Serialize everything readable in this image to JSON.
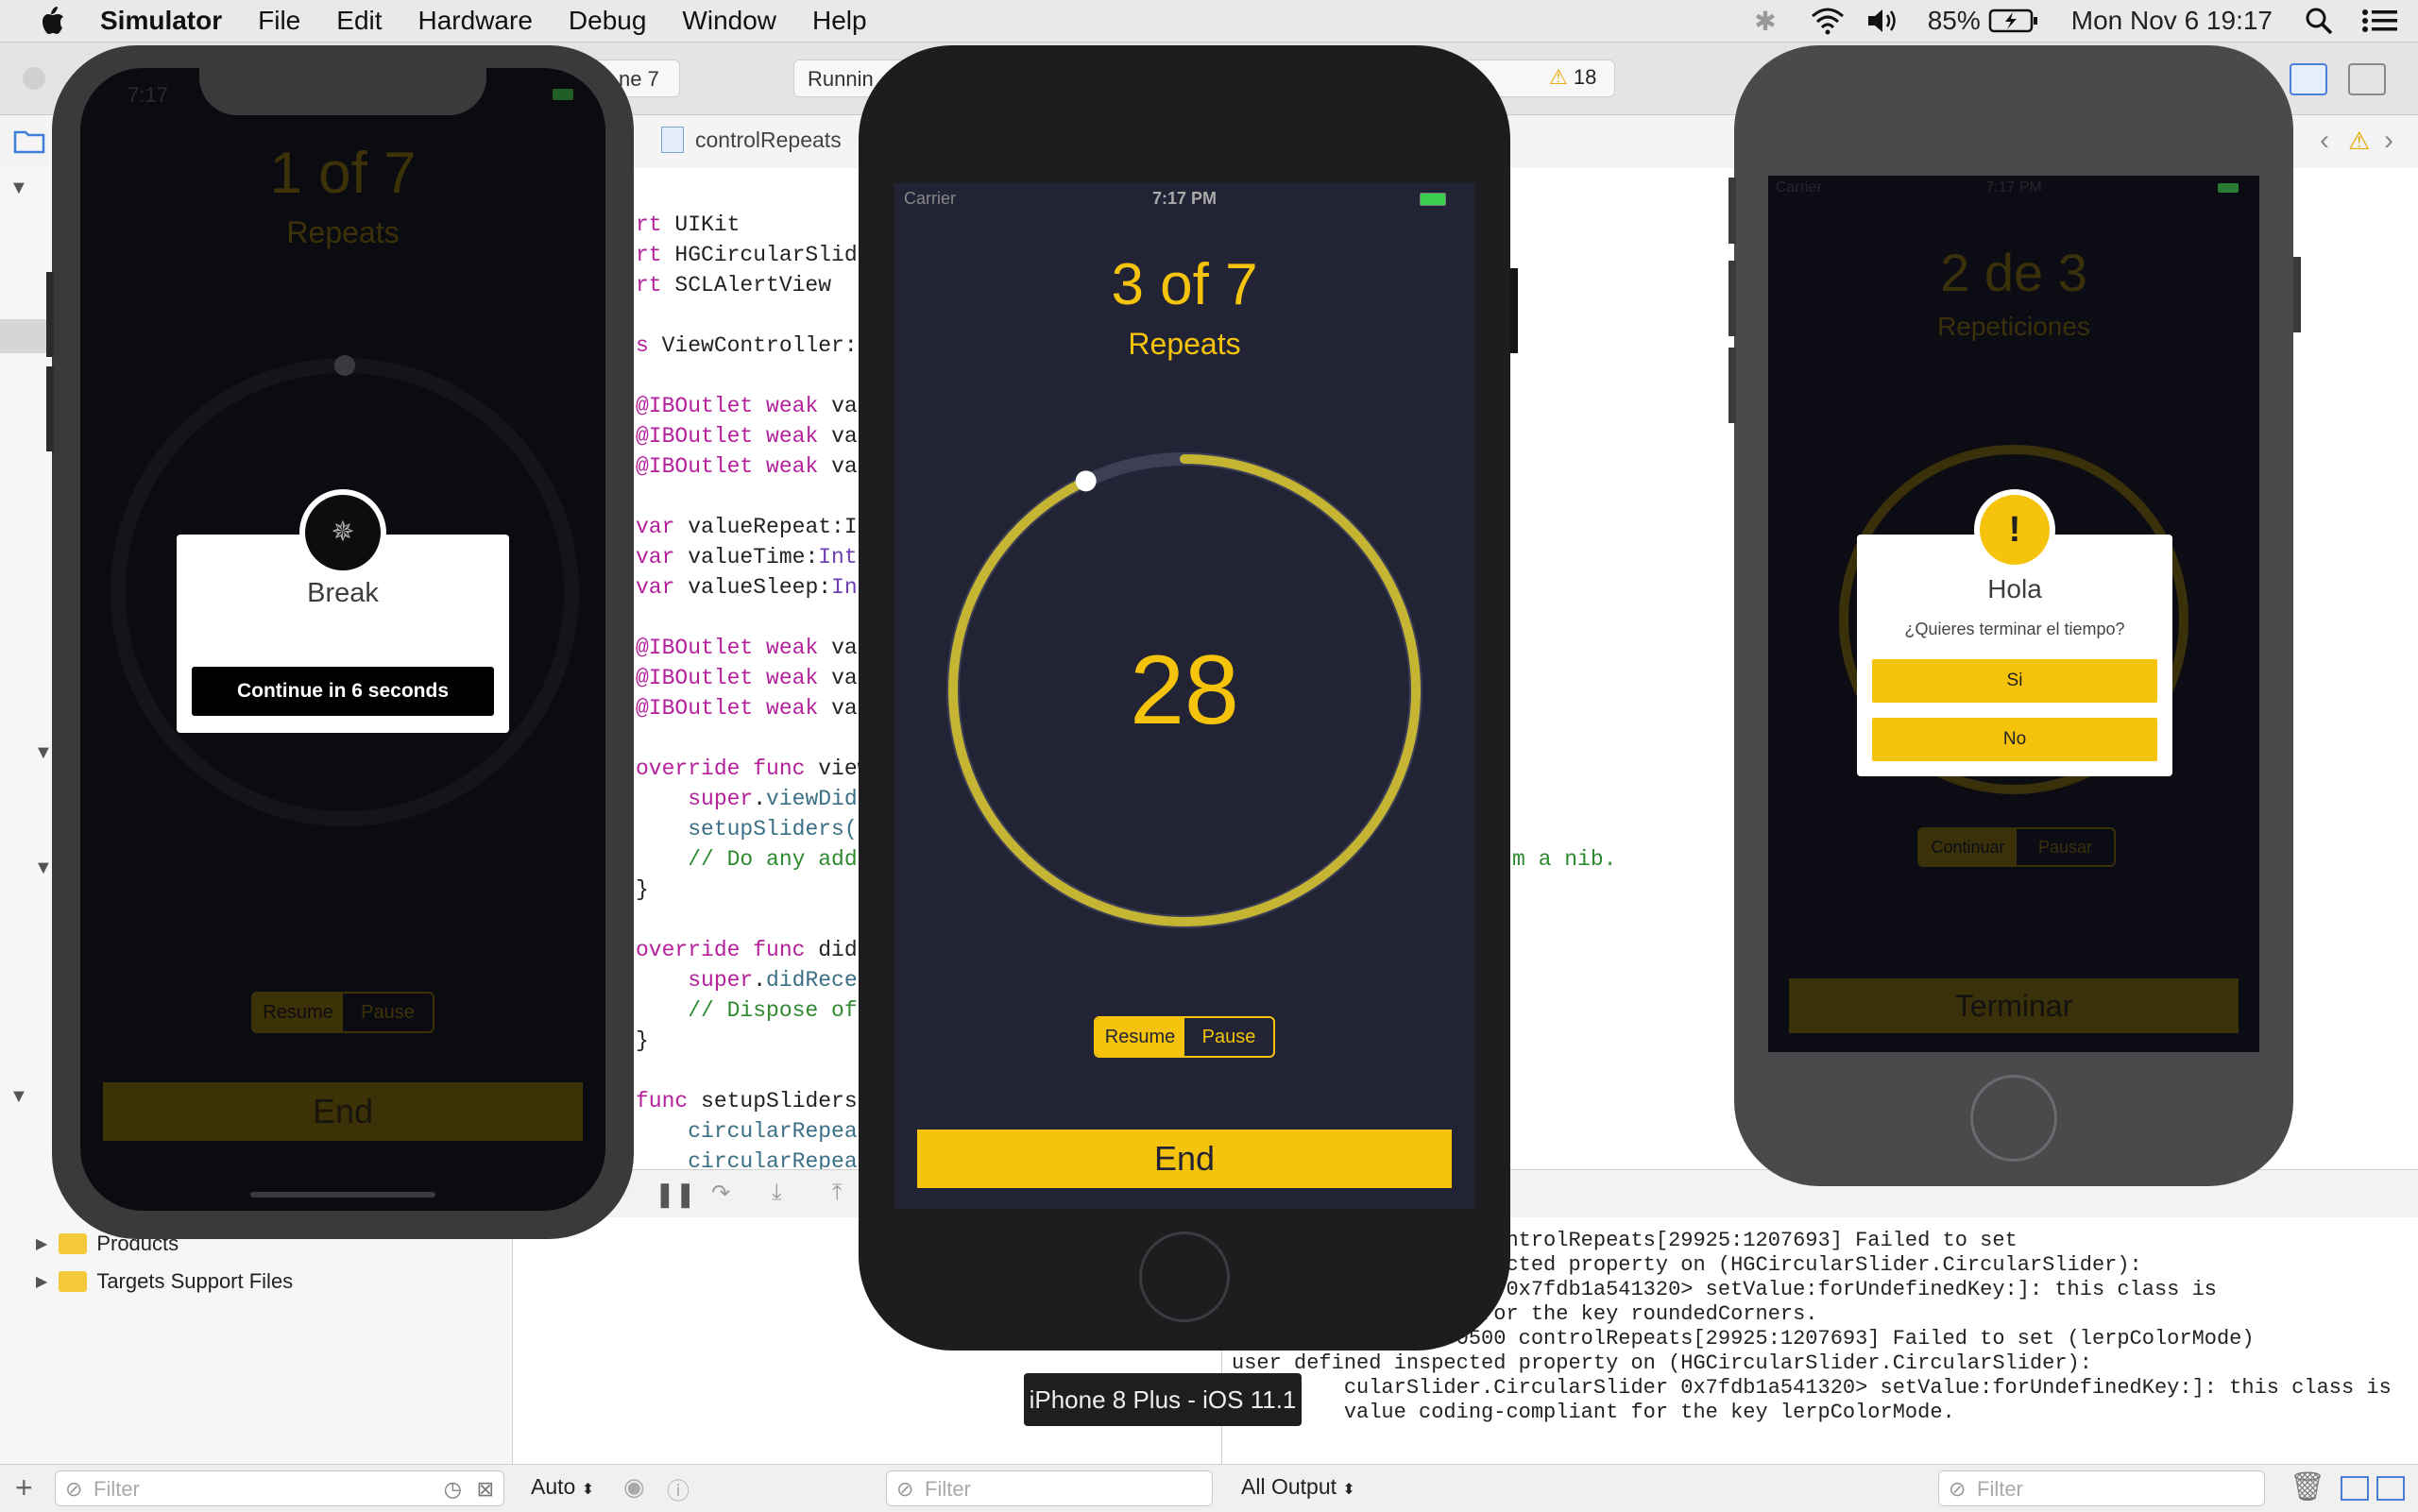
{
  "menubar": {
    "app": "Simulator",
    "items": [
      "File",
      "Edit",
      "Hardware",
      "Debug",
      "Window",
      "Help"
    ],
    "battery": "85%",
    "datetime": "Mon Nov 6  19:17"
  },
  "toolbar": {
    "scheme_fragment": "ne 7",
    "status_fragment": "Runnin",
    "warning_count": "18"
  },
  "navbar": {
    "file_crumb": "controlRepeats"
  },
  "navigator": {
    "items": [
      "Products",
      "Targets Support Files"
    ],
    "filter_placeholder": "Filter"
  },
  "editor": {
    "lines": [
      "rt UIKit",
      "rt HGCircularSlide",
      "rt SCLAlertView",
      "",
      "s ViewController:",
      "",
      "@IBOutlet weak va",
      "@IBOutlet weak va",
      "@IBOutlet weak va",
      "",
      "var valueRepeat:I",
      "var valueTime:Int",
      "var valueSleep:Int",
      "",
      "@IBOutlet weak va",
      "@IBOutlet weak va",
      "@IBOutlet weak va",
      "",
      "override func view",
      "    super.viewDid",
      "    setupSliders(",
      "    // Do any addi",
      "}",
      "",
      "override func didR",
      "    super.didRece",
      "    // Dispose of",
      "}",
      "",
      "func setupSliders",
      "    circularRepea",
      "    circularRepea"
    ],
    "nib_fragment": "m a nib."
  },
  "console": {
    "lines": [
      "                                        ",
      "         32661-0500 controlRepeats[29925:1207693] Failed to set",
      "         defined inspected property on (HGCircularSlider.CircularSlider):",
      "         rcularSlider 0x7fdb1a541320> setValue:forUndefinedKey:]: this class is",
      "         -compliant for the key roundedCorners.",
      "         9.832814-0500 controlRepeats[29925:1207693] Failed to set (lerpColorMode)",
      "user defined inspected property on (HGCircularSlider.CircularSlider):",
      "         cularSlider.CircularSlider 0x7fdb1a541320> setValue:forUndefinedKey:]: this class is",
      "         value coding-compliant for the key lerpColorMode."
    ],
    "output_selector": "All Output",
    "filter_placeholder": "Filter"
  },
  "varsview": {
    "auto_selector": "Auto",
    "filter_placeholder": "Filter"
  },
  "tooltip": "iPhone 8 Plus - iOS 11.1",
  "phoneX": {
    "counter": "1 of 7",
    "subtitle": "Repeats",
    "time_left": "7:17",
    "alert_title": "Break",
    "alert_button": "Continue in 6 seconds",
    "seg_resume": "Resume",
    "seg_pause": "Pause",
    "end": "End"
  },
  "phone8plus": {
    "carrier": "Carrier",
    "time": "7:17 PM",
    "counter": "3 of 7",
    "subtitle": "Repeats",
    "value": "28",
    "progress": 0.93,
    "seg_resume": "Resume",
    "seg_pause": "Pause",
    "end": "End"
  },
  "phone8": {
    "carrier": "Carrier",
    "time": "7:17 PM",
    "counter": "2 de 3",
    "subtitle": "Repeticiones",
    "alert_title": "Hola",
    "alert_message": "¿Quieres terminar el tiempo?",
    "alert_yes": "Si",
    "alert_no": "No",
    "seg_continue": "Continuar",
    "seg_pause": "Pausar",
    "end": "Terminar"
  },
  "colors": {
    "accent": "#f5c30b",
    "slider": "#c6b433",
    "phone_screen": "#222436"
  }
}
